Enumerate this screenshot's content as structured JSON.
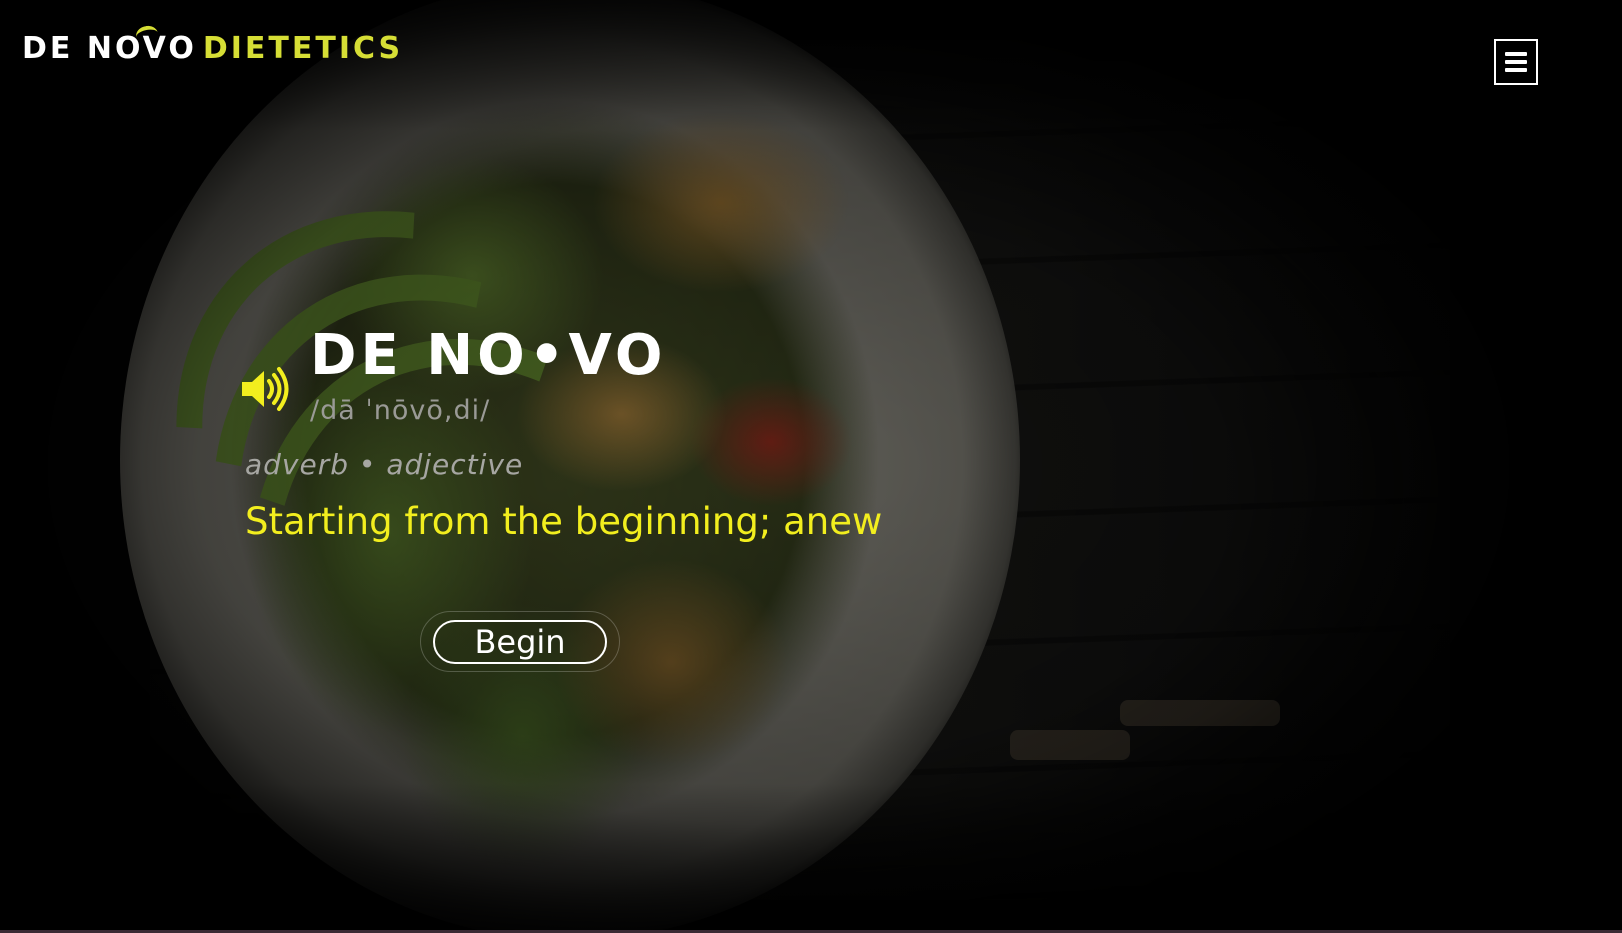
{
  "header": {
    "logo_name": "DE NOVO",
    "logo_suffix": "DIETETICS",
    "menu_icon": "hamburger-icon"
  },
  "definition": {
    "speaker_icon": "speaker-volume-icon",
    "word": "DE NO•VO",
    "pronunciation": "/dā ˈnōvō,di/",
    "part_of_speech": "adverb • adjective",
    "meaning": "Starting from the beginning; anew"
  },
  "cta": {
    "begin_label": "Begin"
  },
  "colors": {
    "accent_yellow": "#f2ee1e",
    "logo_yellow": "#d6de35",
    "text_white": "#ffffff",
    "background": "#000000"
  }
}
